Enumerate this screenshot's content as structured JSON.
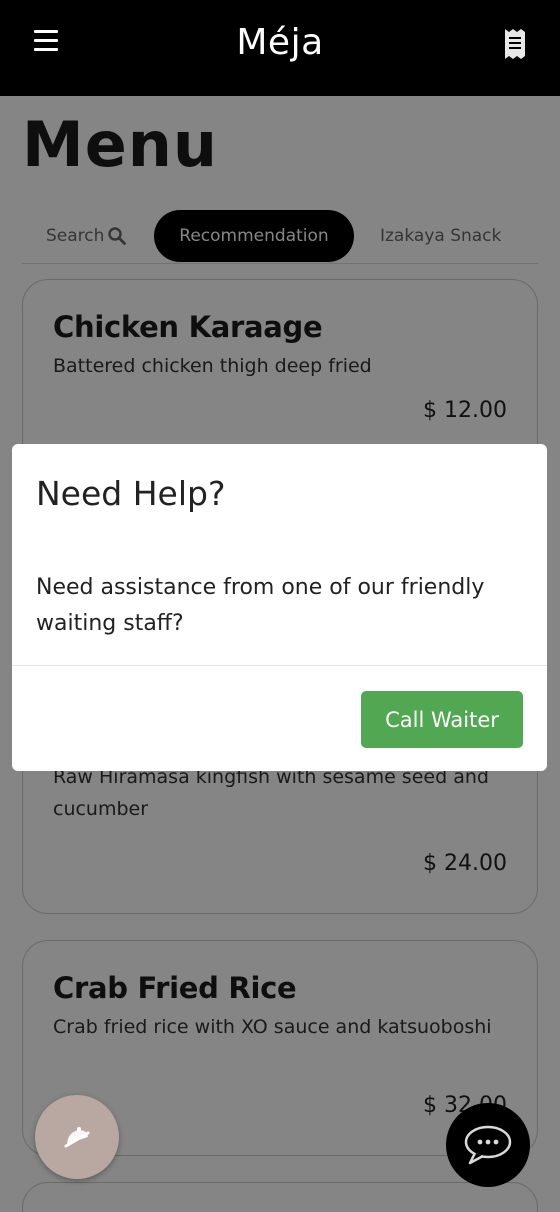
{
  "app": {
    "brand": "Méja"
  },
  "header": {
    "menu_icon": "hamburger-icon",
    "receipt_icon": "receipt-icon"
  },
  "page": {
    "title": "Menu"
  },
  "tabs": [
    {
      "label": "Search",
      "icon": "search-icon"
    },
    {
      "label": "Recommendation",
      "active": true
    },
    {
      "label": "Izakaya Snack"
    }
  ],
  "items": [
    {
      "name": "Chicken Karaage",
      "description": "Battered chicken thigh deep fried",
      "price": "$ 12.00"
    },
    {
      "name": "",
      "description": "Raw Hiramasa kingfish with sesame seed and cucumber",
      "price": "$ 24.00"
    },
    {
      "name": "Crab Fried Rice",
      "description": "Crab fried rice with XO sauce and katsuoboshi",
      "price": "$ 32.00"
    }
  ],
  "modal": {
    "title": "Need Help?",
    "body": "Need assistance from one of our friendly waiting staff?",
    "button": "Call Waiter"
  },
  "fabs": {
    "left_icon": "bell-icon",
    "right_icon": "chat-icon"
  },
  "colors": {
    "header_bg": "#000000",
    "accent_green": "#52a852",
    "fab_left_bg": "#b9a7a1"
  }
}
